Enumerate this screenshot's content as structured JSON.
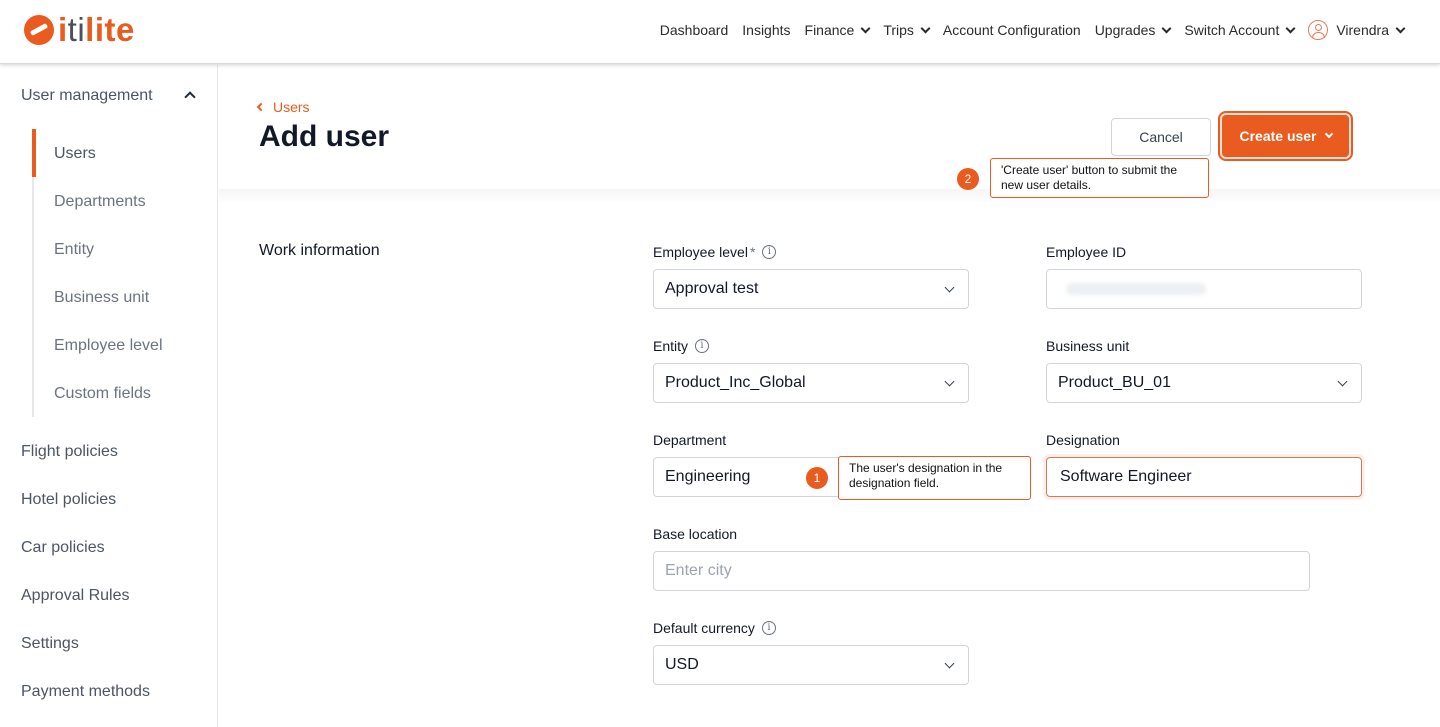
{
  "header": {
    "logo_prefix": "i",
    "logo_mid": "ti",
    "logo_suffix": "lite",
    "nav": {
      "dashboard": "Dashboard",
      "insights": "Insights",
      "finance": "Finance",
      "trips": "Trips",
      "account_configuration": "Account Configuration",
      "upgrades": "Upgrades",
      "switch_account": "Switch Account",
      "user": "Virendra"
    }
  },
  "sidebar": {
    "group": "User management",
    "sub_items": [
      "Users",
      "Departments",
      "Entity",
      "Business unit",
      "Employee level",
      "Custom fields"
    ],
    "main_items": [
      "Flight policies",
      "Hotel policies",
      "Car policies",
      "Approval Rules",
      "Settings",
      "Payment methods"
    ]
  },
  "page": {
    "back_label": "Users",
    "title": "Add user",
    "cancel_label": "Cancel",
    "create_label": "Create user",
    "section_title": "Work information"
  },
  "form": {
    "employee_level": {
      "label": "Employee level",
      "required": "*",
      "value": "Approval test"
    },
    "employee_id": {
      "label": "Employee ID"
    },
    "entity": {
      "label": "Entity",
      "value": "Product_Inc_Global"
    },
    "business_unit": {
      "label": "Business unit",
      "value": "Product_BU_01"
    },
    "department": {
      "label": "Department",
      "value": "Engineering"
    },
    "designation": {
      "label": "Designation",
      "value": "Software Engineer"
    },
    "base_location": {
      "label": "Base location",
      "placeholder": "Enter city"
    },
    "default_currency": {
      "label": "Default currency",
      "value": "USD"
    }
  },
  "annotations": {
    "one": {
      "number": "1",
      "text": "The user's designation in the designation field."
    },
    "two": {
      "number": "2",
      "text": "'Create user' button to submit the new user details."
    }
  },
  "colors": {
    "brand": "#e95b1e"
  },
  "icons": [
    "itilite-logo",
    "chevron-down-icon",
    "chevron-up-icon",
    "chevron-left-icon",
    "user-avatar-icon",
    "info-icon"
  ]
}
